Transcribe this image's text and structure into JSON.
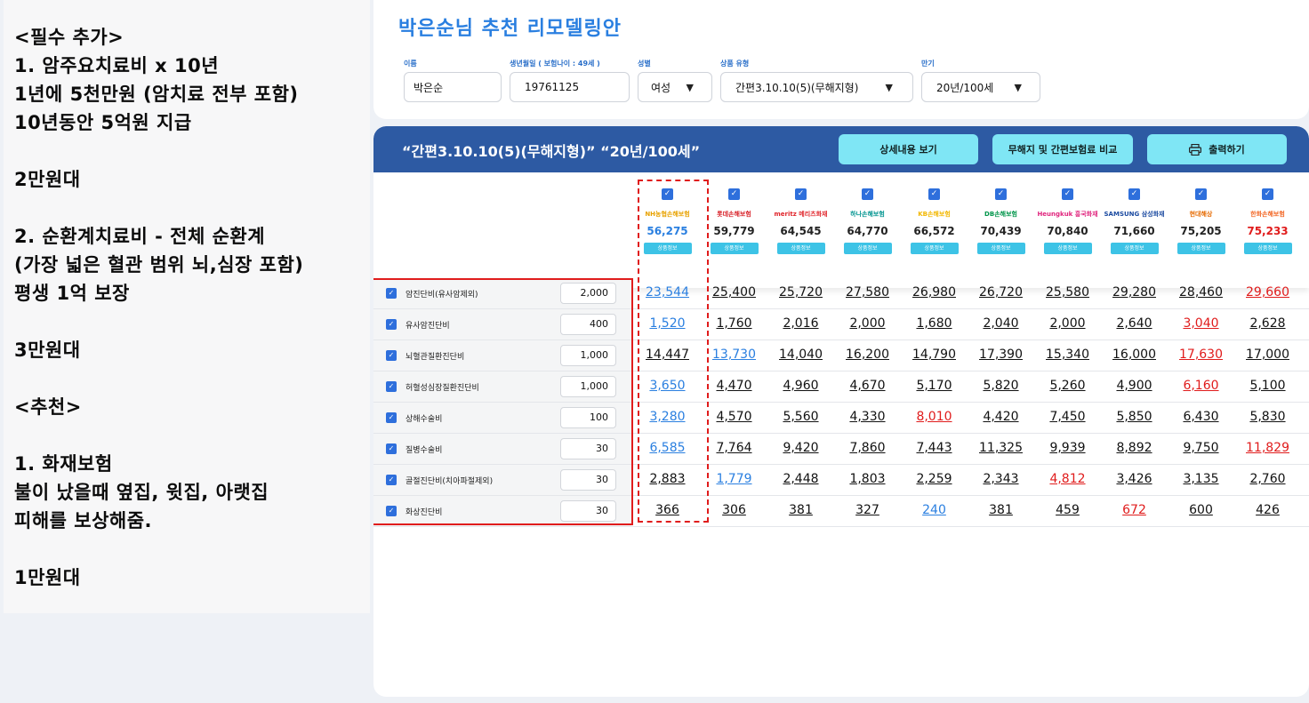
{
  "notes": {
    "lines": [
      "<필수 추가>",
      "1. 암주요치료비 x 10년",
      "1년에 5천만원 (암치료 전부 포함)",
      "10년동안 5억원 지급",
      "2만원대",
      "2. 순환계치료비 - 전체 순환계",
      "(가장 넓은 혈관 범위 뇌,심장 포함)",
      "평생 1억 보장",
      "3만원대",
      "<추천>",
      "1. 화재보험",
      "불이 났을때 옆집, 윗집, 아랫집",
      "피해를 보상해줌.",
      "1만원대"
    ]
  },
  "form": {
    "title": "박은순님 추천 리모델링안",
    "name_label": "이름",
    "name_value": "박은순",
    "birth_label": "생년월일 ( 보험나이 : 49세 )",
    "birth_value": "19761125",
    "gender_label": "성별",
    "gender_value": "여성",
    "product_label": "상품 유형",
    "product_value": "간편3.10.10(5)(무해지형)",
    "term_label": "만기",
    "term_value": "20년/100세"
  },
  "banner": {
    "title": "“간편3.10.10(5)(무해지형)” “20년/100세”",
    "btn_detail": "상세내용 보기",
    "btn_compare": "무해지 및 간편보험료 비교",
    "btn_print": "출력하기"
  },
  "checkbox_mark": "✓",
  "companies": [
    {
      "logo": "NH농협손해보험",
      "premium": "56,275",
      "btn": "상품정보",
      "color": "#e8a200",
      "highlight": "blue"
    },
    {
      "logo": "롯데손해보험",
      "premium": "59,779",
      "btn": "상품정보",
      "color": "#d8232a",
      "highlight": ""
    },
    {
      "logo": "meritz 메리츠화재",
      "premium": "64,545",
      "btn": "상품정보",
      "color": "#e0252b",
      "highlight": ""
    },
    {
      "logo": "하나손해보험",
      "premium": "64,770",
      "btn": "상품정보",
      "color": "#009490",
      "highlight": ""
    },
    {
      "logo": "KB손해보험",
      "premium": "66,572",
      "btn": "상품정보",
      "color": "#f2b700",
      "highlight": ""
    },
    {
      "logo": "DB손해보험",
      "premium": "70,439",
      "btn": "상품정보",
      "color": "#00954a",
      "highlight": ""
    },
    {
      "logo": "Heungkuk 흥국화재",
      "premium": "70,840",
      "btn": "상품정보",
      "color": "#e0267e",
      "highlight": ""
    },
    {
      "logo": "SAMSUNG 삼성화재",
      "premium": "71,660",
      "btn": "상품정보",
      "color": "#1b4aa0",
      "highlight": ""
    },
    {
      "logo": "현대해상",
      "premium": "75,205",
      "btn": "상품정보",
      "color": "#e66a00",
      "highlight": ""
    },
    {
      "logo": "한화손해보험",
      "premium": "75,233",
      "btn": "상품정보",
      "color": "#f26522",
      "highlight": "red"
    }
  ],
  "rows": [
    {
      "name": "암진단비(유사암제외)",
      "amount": "2,000",
      "values": [
        "23,544",
        "25,400",
        "25,720",
        "27,580",
        "26,980",
        "26,720",
        "25,580",
        "29,280",
        "28,460",
        "29,660"
      ],
      "blue": [
        0
      ],
      "red": [
        9
      ]
    },
    {
      "name": "유사암진단비",
      "amount": "400",
      "values": [
        "1,520",
        "1,760",
        "2,016",
        "2,000",
        "1,680",
        "2,040",
        "2,000",
        "2,640",
        "3,040",
        "2,628"
      ],
      "blue": [
        0
      ],
      "red": [
        8
      ]
    },
    {
      "name": "뇌혈관질환진단비",
      "amount": "1,000",
      "values": [
        "14,447",
        "13,730",
        "14,040",
        "16,200",
        "14,790",
        "17,390",
        "15,340",
        "16,000",
        "17,630",
        "17,000"
      ],
      "blue": [
        1
      ],
      "red": [
        8
      ]
    },
    {
      "name": "허혈성심장질환진단비",
      "amount": "1,000",
      "values": [
        "3,650",
        "4,470",
        "4,960",
        "4,670",
        "5,170",
        "5,820",
        "5,260",
        "4,900",
        "6,160",
        "5,100"
      ],
      "blue": [
        0
      ],
      "red": [
        8
      ]
    },
    {
      "name": "상해수술비",
      "amount": "100",
      "values": [
        "3,280",
        "4,570",
        "5,560",
        "4,330",
        "8,010",
        "4,420",
        "7,450",
        "5,850",
        "6,430",
        "5,830"
      ],
      "blue": [
        0
      ],
      "red": [
        4
      ]
    },
    {
      "name": "질병수술비",
      "amount": "30",
      "values": [
        "6,585",
        "7,764",
        "9,420",
        "7,860",
        "7,443",
        "11,325",
        "9,939",
        "8,892",
        "9,750",
        "11,829"
      ],
      "blue": [
        0
      ],
      "red": [
        9
      ]
    },
    {
      "name": "골절진단비(치아파절제외)",
      "amount": "30",
      "values": [
        "2,883",
        "1,779",
        "2,448",
        "1,803",
        "2,259",
        "2,343",
        "4,812",
        "3,426",
        "3,135",
        "2,760"
      ],
      "blue": [
        1
      ],
      "red": [
        6
      ]
    },
    {
      "name": "화상진단비",
      "amount": "30",
      "values": [
        "366",
        "306",
        "381",
        "327",
        "240",
        "381",
        "459",
        "672",
        "600",
        "426"
      ],
      "blue": [
        4
      ],
      "red": [
        7
      ]
    }
  ]
}
